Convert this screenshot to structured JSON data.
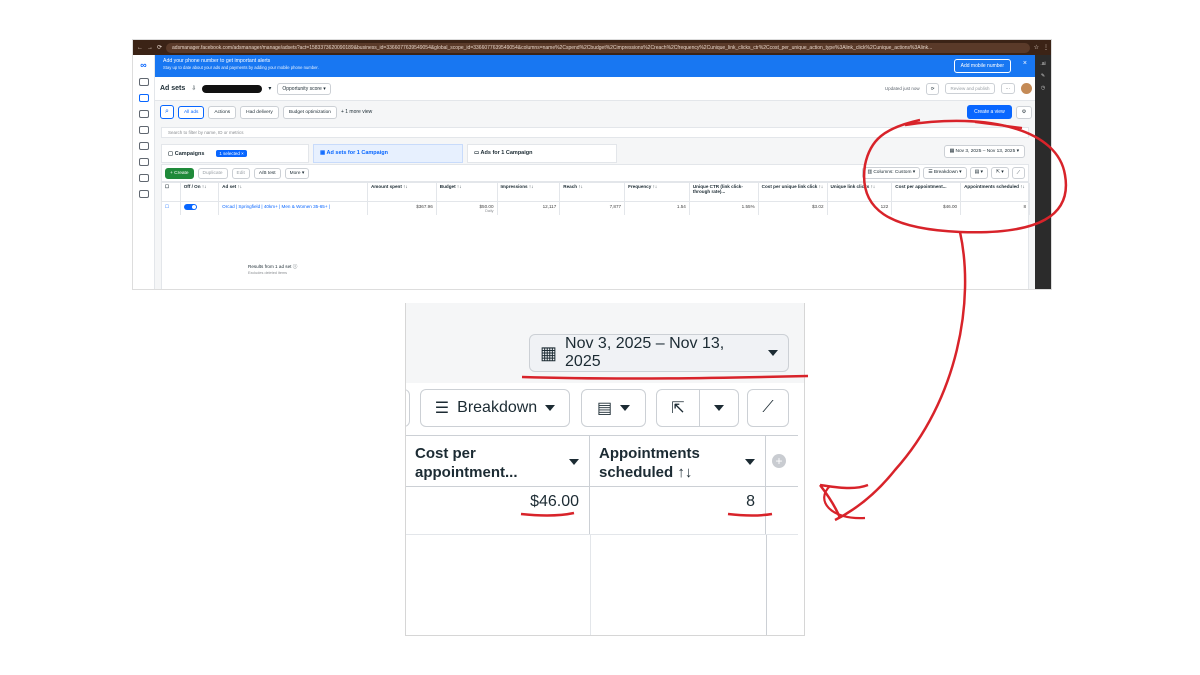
{
  "browser": {
    "url": "adsmanager.facebook.com/adsmanager/manage/adsets?act=1583373620090189&business_id=3366077639549054&global_scope_id=3366077639549054&columns=name%2Cspend%2Cbudget%2Cimpressions%2Creach%2Cfrequency%2Cunique_link_clicks_ctr%2Ccost_per_unique_action_type%3Alink_click%2Cunique_actions%3Alink..."
  },
  "alert": {
    "title": "Add your phone number to get important alerts",
    "subtitle": "Stay up to date about your ads and payments by adding your mobile phone number.",
    "button": "Add mobile number",
    "close": "×"
  },
  "header": {
    "title": "Ad sets",
    "opportunity": "Opportunity score",
    "updated": "Updated just now",
    "review": "Review and publish",
    "more": "···"
  },
  "filters": {
    "all_ads": "All ads",
    "actions": "Actions",
    "had_delivery": "Had delivery",
    "budget_opt": "Budget optimization",
    "more_view": "+ 1 more view",
    "create_view": "Create a view",
    "search_placeholder": "Search to filter by name, ID or metrics"
  },
  "tabs": {
    "campaigns": "Campaigns",
    "selected": "1 selected",
    "adsets": "Ad sets for 1 Campaign",
    "ads": "Ads for 1 Campaign"
  },
  "date_range": "Nov 3, 2025 – Nov 13, 2025",
  "actions": {
    "create": "+ Create",
    "duplicate": "Duplicate",
    "edit": "Edit",
    "ab_test": "A/B test",
    "more": "More",
    "columns": "Columns: Custom",
    "breakdown": "Breakdown"
  },
  "table": {
    "headers": [
      "",
      "Off / On ↑↓",
      "Ad set ↑↓",
      "Amount spent ↑↓",
      "Budget ↑↓",
      "Impressions ↑↓",
      "Reach ↑↓",
      "Frequency ↑↓",
      "Unique CTR (link click-through rate)...",
      "Cost per unique link click ↑↓",
      "Unique link clicks ↑↓",
      "Cost per appointment...",
      "Appointments scheduled ↑↓"
    ],
    "row": {
      "name": "Orcad | Springfield | 40km+ | Men & Women 35-65+ |",
      "spent": "$367.96",
      "budget": "$50.00",
      "budget_sub": "Daily",
      "impressions": "12,117",
      "reach": "7,877",
      "frequency": "1.54",
      "ctr": "1.55%",
      "cpulc": "$3.02",
      "ulc": "122",
      "cpa": "$46.00",
      "appts": "8"
    },
    "results": "Results from 1 ad set",
    "results_sub": "Excludes deleted items"
  },
  "zoom": {
    "date_range": "Nov 3, 2025 – Nov 13, 2025",
    "breakdown": "Breakdown",
    "col1": "Cost per appointment...",
    "col2": "Appointments scheduled ↑↓",
    "val1": "$46.00",
    "val2": "8"
  },
  "colors": {
    "accent": "#0866ff",
    "annotation": "#d8232a",
    "create": "#1f8a3a"
  }
}
